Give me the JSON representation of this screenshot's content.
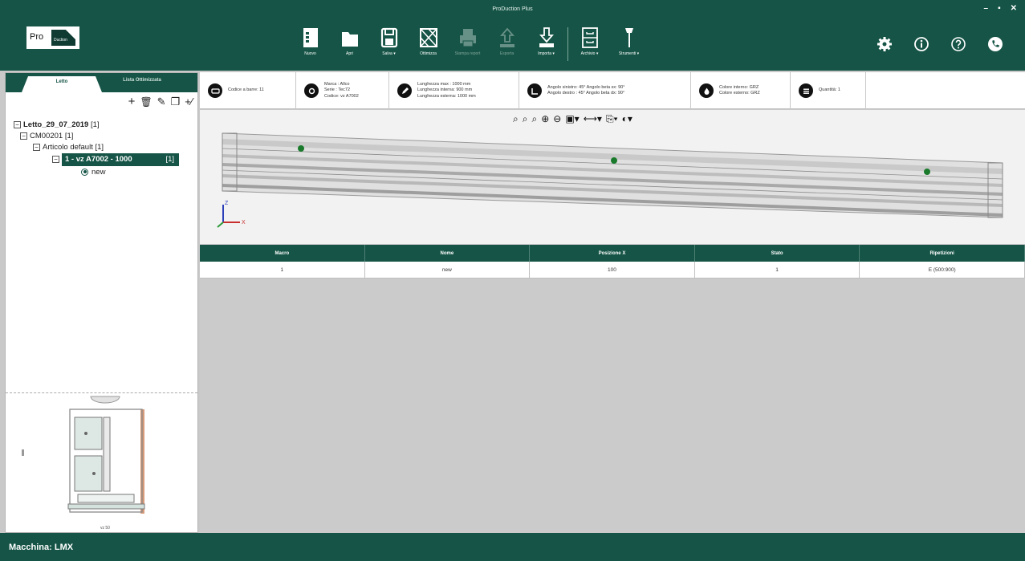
{
  "app": {
    "title": "ProDuction Plus",
    "logo_text_pro": "Pro",
    "logo_text_duction": "Duction"
  },
  "window_controls": {
    "minimize": "–",
    "maximize": "▪",
    "close": "✕"
  },
  "toolbar": {
    "buttons": [
      {
        "name": "nuovo",
        "label": "Nuovo",
        "icon": "new-document-icon",
        "enabled": true
      },
      {
        "name": "apri",
        "label": "Apri",
        "icon": "open-folder-icon",
        "enabled": true
      },
      {
        "name": "salva",
        "label": "Salva ▾",
        "icon": "save-icon",
        "enabled": true
      },
      {
        "name": "ottimizza",
        "label": "Ottimizza",
        "icon": "optimize-icon",
        "enabled": true
      },
      {
        "name": "stampa-report",
        "label": "Stampa report",
        "icon": "printer-icon",
        "enabled": false
      },
      {
        "name": "esporta",
        "label": "Esporta",
        "icon": "upload-icon",
        "enabled": false
      },
      {
        "name": "importa",
        "label": "Importa ▾",
        "icon": "import-icon",
        "enabled": true
      },
      {
        "name": "archivio",
        "label": "Archivio ▾",
        "icon": "archive-icon",
        "enabled": true
      },
      {
        "name": "strumenti",
        "label": "Strumenti ▾",
        "icon": "tools-icon",
        "enabled": true
      }
    ]
  },
  "right_icons": [
    "settings-icon",
    "info-icon",
    "help-icon",
    "phone-icon"
  ],
  "left_panel": {
    "tabs": [
      {
        "label": "Letto"
      },
      {
        "label": "Lista Ottimizzata"
      }
    ],
    "tools": [
      "+",
      "🗑",
      "✎",
      "❐",
      "+⁄"
    ],
    "tree": {
      "root": "Letto_29_07_2019",
      "root_count": "[1]",
      "l1": "CM00201 [1]",
      "l2": "Articolo default [1]",
      "l3": "1 - vz A7002 - 1000",
      "l3_count": "[1]",
      "l4": "new"
    },
    "profile_caption": "vz 50"
  },
  "info_bar": {
    "cells": [
      {
        "icon": "barcode-icon",
        "lines": [
          "Codice a barre: 11"
        ]
      },
      {
        "icon": "tag-icon",
        "lines": [
          "Marca : Allco",
          "Serie : Tec72",
          "Codice: vz A7002"
        ]
      },
      {
        "icon": "pencil-icon",
        "lines": [
          "Lunghezza max    : 1000 mm",
          "Lunghezza interna: 900  mm",
          "Lunghezza esterna: 1000 mm"
        ]
      },
      {
        "icon": "angle-icon",
        "lines": [
          "Angolo sinistro: 45°   Angolo beta sx: 90°",
          "Angolo destro  : 45°   Angolo beta dx: 90°"
        ]
      },
      {
        "icon": "color-icon",
        "lines": [
          "Colore interno: GRZ",
          "Colore esterno: GRZ"
        ]
      },
      {
        "icon": "quantity-icon",
        "lines": [
          "Quantità: 1"
        ]
      }
    ]
  },
  "viewer": {
    "tools": [
      "⌕",
      "⌕",
      "⌕",
      "⊕",
      "⊖",
      "▣▾",
      "⟷▾",
      "⎘▾",
      "◐▾"
    ],
    "axis_z": "Z",
    "axis_x": "X"
  },
  "table": {
    "headers": [
      "Macro",
      "Nome",
      "Posizione X",
      "Stato",
      "Ripetizioni"
    ],
    "rows": [
      [
        "1",
        "new",
        "100",
        "1",
        "E (500:900)"
      ]
    ]
  },
  "status": {
    "machine": "Macchina:  LMX"
  },
  "colors": {
    "primary": "#155446",
    "accent_dot": "#1a7a2c"
  }
}
